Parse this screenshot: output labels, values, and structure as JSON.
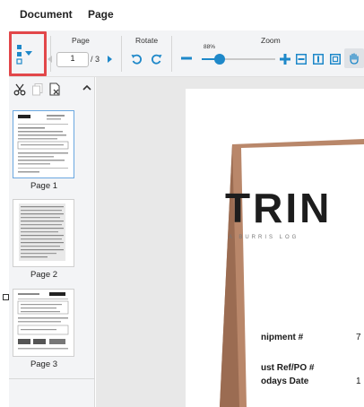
{
  "menu": {
    "document": "Document",
    "page": "Page"
  },
  "toolbar": {
    "page_group_label": "Page",
    "rotate_group_label": "Rotate",
    "zoom_group_label": "Zoom",
    "current_page": "1",
    "page_total": "/ 3",
    "zoom_percent": "88%",
    "zoom_level": 0.24,
    "icons": [
      "view-mode-icon",
      "chevron-down-icon",
      "previous-page-icon",
      "next-page-icon",
      "rotate-left-icon",
      "rotate-right-icon",
      "zoom-out-icon",
      "zoom-in-icon",
      "fit-width-icon",
      "fit-page-icon",
      "actual-size-icon",
      "pan-hand-icon"
    ]
  },
  "sidebar": {
    "tools": [
      "scissors-icon",
      "copy-icon",
      "delete-page-icon",
      "collapse-up-icon"
    ],
    "thumbnails": [
      {
        "label": "Page 1",
        "selected": true
      },
      {
        "label": "Page 2",
        "selected": false
      },
      {
        "label": "Page 3",
        "selected": false
      }
    ]
  },
  "document": {
    "logo_text": "TRIN",
    "logo_sub": "A BURRIS LOG",
    "fields": [
      {
        "label": "nipment #",
        "value": "7"
      },
      {
        "label": "ust Ref/PO #",
        "value": ""
      },
      {
        "label": "odays Date",
        "value": "1"
      }
    ]
  },
  "colors": {
    "accent": "#1e88c9",
    "highlight": "#e2474a",
    "toolbar_bg": "#f3f4f6",
    "page_shadow_wood": "#b9876a"
  }
}
